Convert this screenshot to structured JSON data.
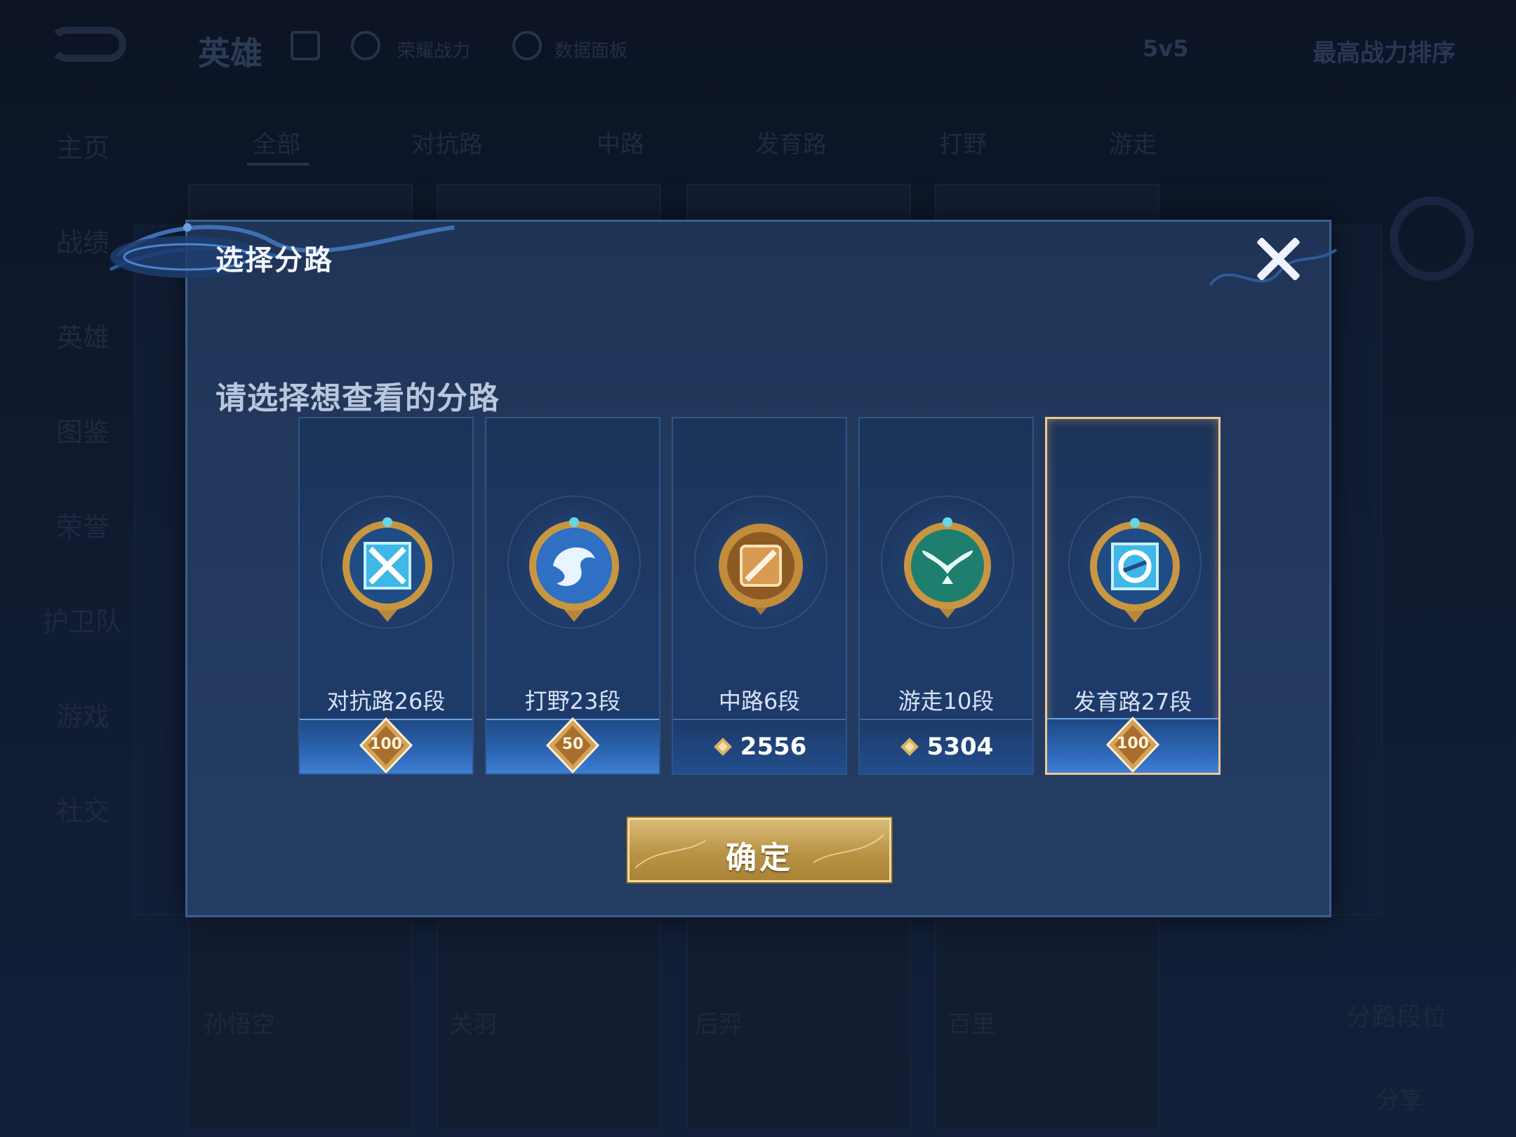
{
  "background": {
    "title": "英雄",
    "top_items": [
      "荣耀战力",
      "数据面板"
    ],
    "mode": "5v5",
    "sort": "最高战力排序",
    "side_items": [
      "主页",
      "战绩",
      "英雄",
      "图鉴",
      "荣誉",
      "护卫队",
      "游戏",
      "社交"
    ],
    "tabs": [
      "全部",
      "对抗路",
      "中路",
      "发育路",
      "打野",
      "游走"
    ],
    "hero_names": [
      "孙悟空",
      "关羽",
      "后羿",
      "百里"
    ],
    "lane_rank": "分路段位",
    "share": "分享"
  },
  "modal": {
    "title": "选择分路",
    "subtitle": "请选择想查看的分路",
    "confirm": "确定"
  },
  "lanes": [
    {
      "label": "对抗路26段",
      "badge": "100",
      "type": "badge",
      "icon": "crossed-swords-icon",
      "color": "#3fb7e8"
    },
    {
      "label": "打野23段",
      "badge": "50",
      "type": "badge",
      "icon": "dragon-icon",
      "color": "#2f6fc4"
    },
    {
      "label": "中路6段",
      "score": "2556",
      "type": "score",
      "icon": "staff-icon",
      "color": "#d79b52"
    },
    {
      "label": "游走10段",
      "score": "5304",
      "type": "score",
      "icon": "wings-icon",
      "color": "#2a9a86"
    },
    {
      "label": "发育路27段",
      "badge": "100",
      "type": "badge",
      "icon": "bow-icon",
      "color": "#3fb7e8",
      "selected": true
    }
  ]
}
